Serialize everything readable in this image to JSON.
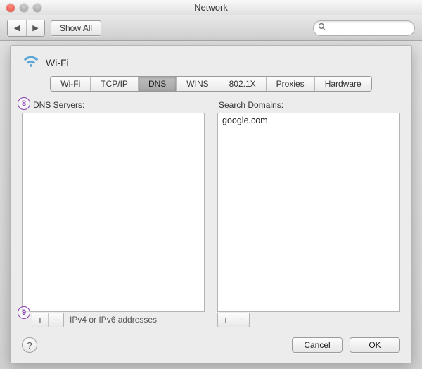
{
  "window": {
    "title": "Network"
  },
  "toolbar": {
    "show_all": "Show All"
  },
  "sheet": {
    "title": "Wi-Fi",
    "tabs": [
      "Wi-Fi",
      "TCP/IP",
      "DNS",
      "WINS",
      "802.1X",
      "Proxies",
      "Hardware"
    ],
    "active_tab_index": 2
  },
  "dns": {
    "label": "DNS Servers:",
    "items": [],
    "hint": "IPv4 or IPv6 addresses"
  },
  "search_domains": {
    "label": "Search Domains:",
    "items": [
      "google.com"
    ]
  },
  "buttons": {
    "cancel": "Cancel",
    "ok": "OK",
    "help": "?"
  },
  "annotations": {
    "a8": "8",
    "a9": "9"
  },
  "icons": {
    "back": "◀",
    "forward": "▶",
    "plus": "+",
    "minus": "−"
  }
}
